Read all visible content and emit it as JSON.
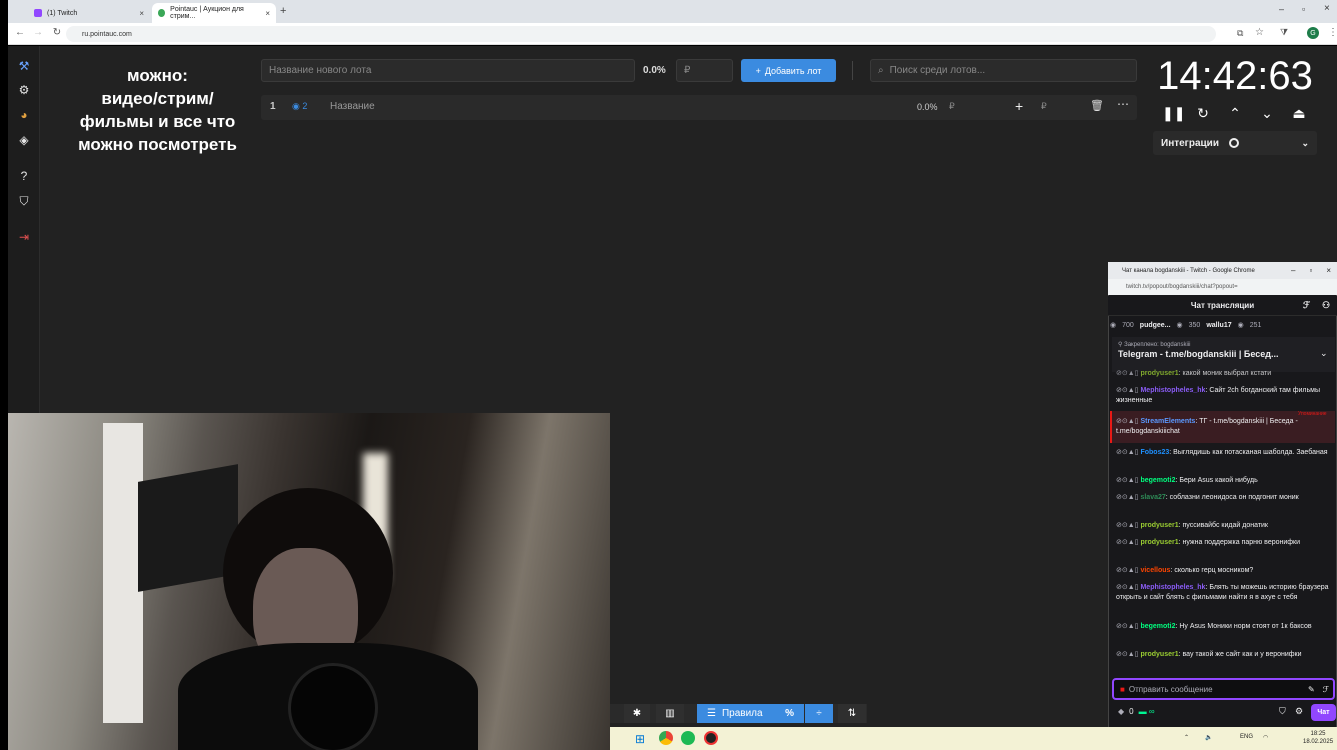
{
  "browser": {
    "tabs": [
      {
        "label": "(1) Twitch"
      },
      {
        "label": "Pointauc | Аукцион для стрим..."
      }
    ],
    "url": "ru.pointauc.com",
    "profile_initial": "G"
  },
  "overlay_text": [
    "можно:",
    "видео/стрим/",
    "фильмы и все что",
    "можно посмотреть"
  ],
  "lot_form": {
    "name_placeholder": "Название нового лота",
    "percent": "0.0%",
    "amount_placeholder": "₽",
    "add_button": "Добавить лот",
    "search_placeholder": "Поиск среди лотов..."
  },
  "lot": {
    "number": "1",
    "badge": "2",
    "name": "Название",
    "percent": "0.0%",
    "currency": "₽"
  },
  "timer": {
    "value": "14:42:63"
  },
  "integrations": {
    "label": "Интеграции"
  },
  "bottom_toolbar": {
    "rules_label": "Правила",
    "percent_label": "%"
  },
  "chat": {
    "window_title": "Чат канала bogdanskiii - Twitch - Google Chrome",
    "url": "twitch.tv/popout/bogdanskiii/chat?popout=",
    "header": "Чат трансляции",
    "viewers": [
      {
        "count": "700"
      },
      {
        "name": "pudgee..."
      },
      {
        "count": "350"
      },
      {
        "name": "wallu17"
      },
      {
        "count": "251"
      }
    ],
    "pinned": {
      "label": "Закреплено:",
      "author": "bogdanskiii",
      "text": "Telegram - t.me/bogdanskiii | Бесед..."
    },
    "messages": [
      {
        "user": "prodyuser1",
        "color": "#9acd32",
        "text": "какой моник выбрал кстати"
      },
      {
        "user": "Mephistopheles_hk",
        "color": "#8a5cf5",
        "text": "Сайт 2ch богданский там фильмы жизненные"
      },
      {
        "user": "StreamElements",
        "color": "#5b99ff",
        "text": "ТГ - t.me/bogdanskiii | Беседа - t.me/bogdanskiiichat",
        "mention": "Упоминание"
      },
      {
        "user": "Fobos23",
        "color": "#1e90ff",
        "text": "Выглядишь как потасканая шаболда. Заебаная"
      },
      {
        "user": "begemoti2",
        "color": "#00ff7f",
        "text": "Бери Asus какой нибудь"
      },
      {
        "user": "slava27",
        "color": "#2e8b57",
        "text": "соблазни леонидоса он подгонит моник"
      },
      {
        "user": "prodyuser1",
        "color": "#9acd32",
        "text": "пуссивайбс кидай донатик"
      },
      {
        "user": "prodyuser1",
        "color": "#9acd32",
        "text": "нужна поддержка парню веронифки"
      },
      {
        "user": "vicellous",
        "color": "#ff4500",
        "text": "сколько герц мосником?"
      },
      {
        "user": "Mephistopheles_hk",
        "color": "#8a5cf5",
        "text": "Блять ты можешь историю браузера открыть и сайт блять с фильмами найти я в ахуе с тебя"
      },
      {
        "user": "begemoti2",
        "color": "#00ff7f",
        "text": "Ну Asus Моники норм стоят от 1к баксов"
      },
      {
        "user": "prodyuser1",
        "color": "#9acd32",
        "text": "вау такой же сайт как и у веронифки"
      }
    ],
    "input_placeholder": "Отправить сообщение",
    "points": "0",
    "chat_button": "Чат"
  },
  "taskbar": {
    "lang": "ENG",
    "time": "18:25",
    "date": "18.02.2025"
  },
  "colors": {
    "accent": "#3b8be0",
    "twitch": "#9147ff",
    "app_bg": "#222222"
  }
}
